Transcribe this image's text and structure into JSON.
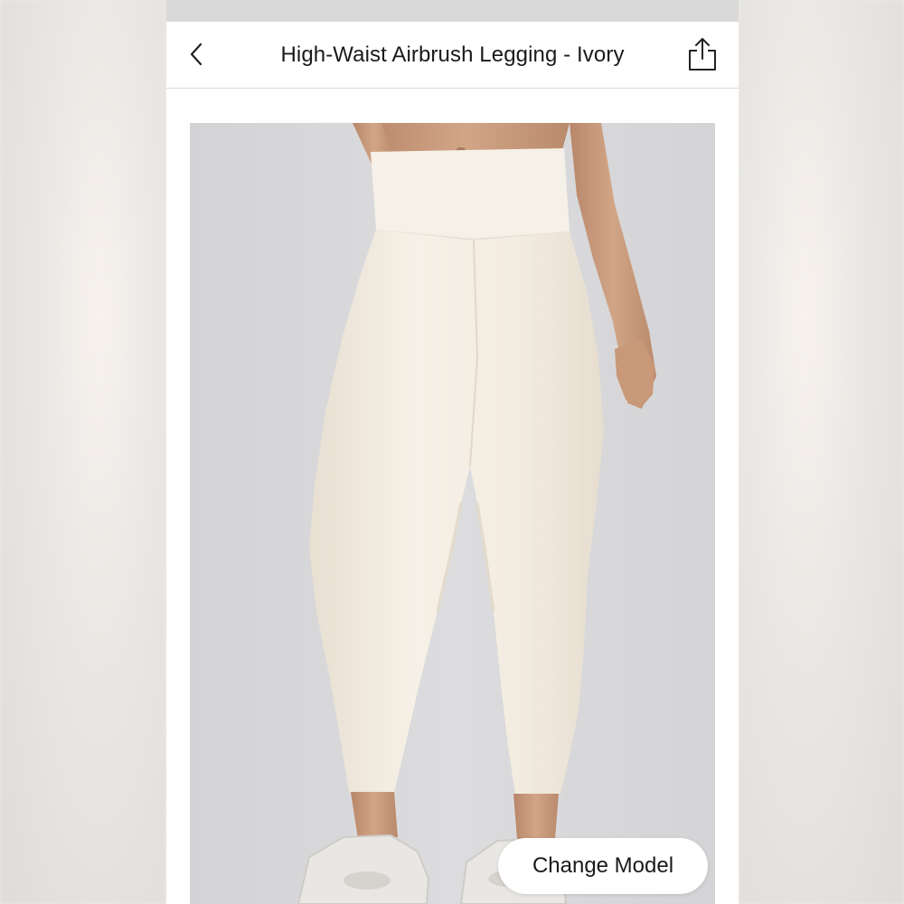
{
  "header": {
    "title": "High-Waist Airbrush Legging - Ivory",
    "back_icon": "chevron-left-icon",
    "share_icon": "share-icon"
  },
  "product_image": {
    "alt": "Model wearing High-Waist Airbrush Legging in Ivory"
  },
  "change_model": {
    "label": "Change Model"
  },
  "colors": {
    "legging": "#f3ece1",
    "skin": "#c99a7c",
    "image_background": "#d7d7d9",
    "sandal": "#e8e6e2"
  }
}
